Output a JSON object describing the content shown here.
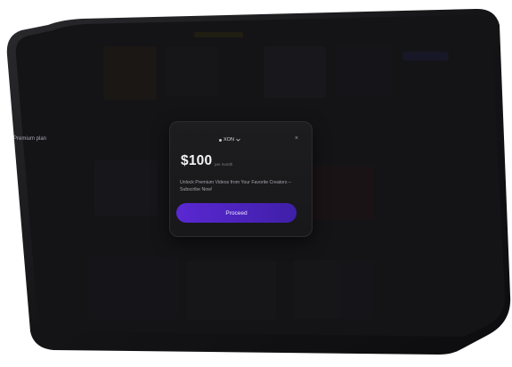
{
  "modal": {
    "plan_label": "Premium plan",
    "currency": "XON",
    "price": "$100",
    "period": "per month",
    "description": "Unlock Premium Videos from Your Favorite Creators – Subscribe Now!",
    "proceed_label": "Proceed"
  },
  "icons": {
    "currency": "currency-dot-icon",
    "chevron": "chevron-down-icon",
    "close": "close-icon"
  },
  "colors": {
    "tablet_frame": "#121214",
    "screen_background": "#1a1a1d",
    "modal_background": "#1b1b1e",
    "accent": "#5a28d2"
  }
}
